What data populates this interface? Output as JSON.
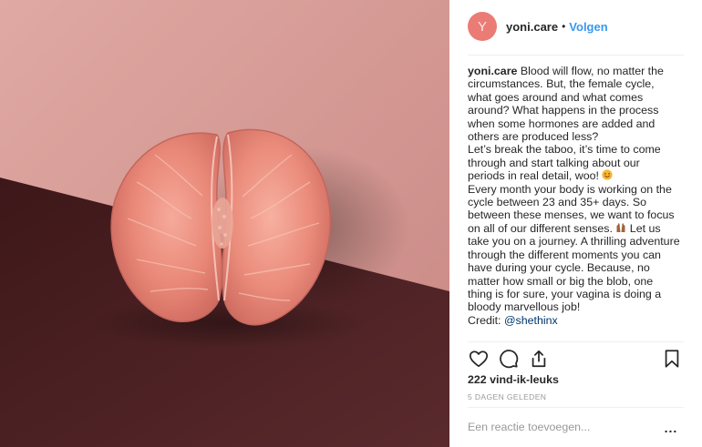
{
  "post": {
    "image_alt_icon": "grapefruit-photo",
    "author": {
      "username": "yoni.care",
      "avatar_letter": "Y",
      "separator": "•",
      "follow_label": "Volgen"
    },
    "caption": {
      "username": "yoni.care",
      "lines": [
        "Blood will flow, no matter the",
        "circumstances. But, the female cycle,",
        "what goes around and what comes",
        "around? What happens in the process",
        "when some hormones are added and",
        "others are produced less?",
        "Let’s break the taboo, it’s time to come",
        "through and start talking about our",
        "periods in real detail, woo!",
        "Every month your body is working on the",
        "cycle between 23 and 35+ days. So",
        "between these menses, we want to focus",
        "on all of our different senses.",
        "Let us",
        "take you on a journey. A thrilling adventure",
        "through the different moments you can",
        "have during your cycle. Because, no",
        "matter how small or big the blob, one",
        "thing is for sure, your vagina is doing a",
        "bloody marvellous job!"
      ],
      "credit_label": "Credit:",
      "credit_handle": "@shethinx",
      "emoji_1": "smiling-face-icon",
      "emoji_2": "raised-hands-icon"
    },
    "actions": {
      "like_icon": "heart-icon",
      "comment_icon": "comment-icon",
      "share_icon": "share-icon",
      "save_icon": "bookmark-icon"
    },
    "likes_text": "222 vind-ik-leuks",
    "time_ago": "5 DAGEN GELEDEN",
    "comment_placeholder": "Een reactie toevoegen...",
    "more_label": "...",
    "colors": {
      "follow": "#3897f0",
      "avatar": "#ea7c75",
      "background_pink": "#d49a94",
      "background_maroon": "#4a1f22"
    }
  }
}
